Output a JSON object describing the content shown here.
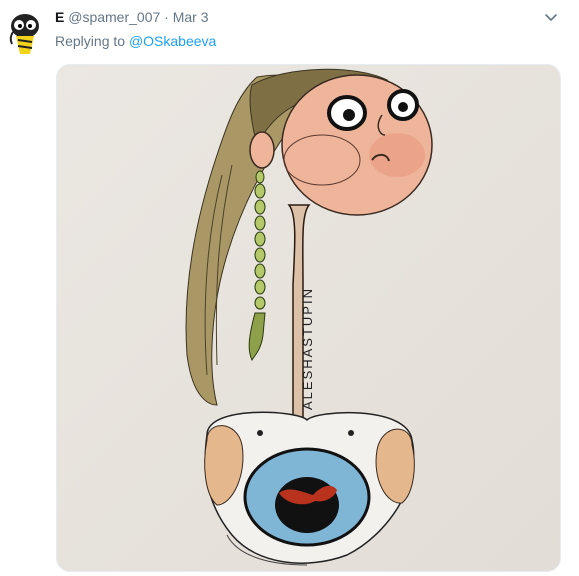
{
  "tweet": {
    "display_name": "E",
    "handle": "@spamer_007",
    "separator": "·",
    "timestamp": "Mar 3",
    "reply_prefix": "Replying to",
    "reply_to": "@OSkabeeva"
  },
  "media": {
    "vertical_text": "ALESHASTUPIN"
  },
  "icons": {
    "avatar": "cartoon-avatar-icon",
    "menu": "chevron-down-icon"
  },
  "colors": {
    "link": "#1da1f2",
    "secondary_text": "#657786",
    "primary_text": "#14171a"
  }
}
